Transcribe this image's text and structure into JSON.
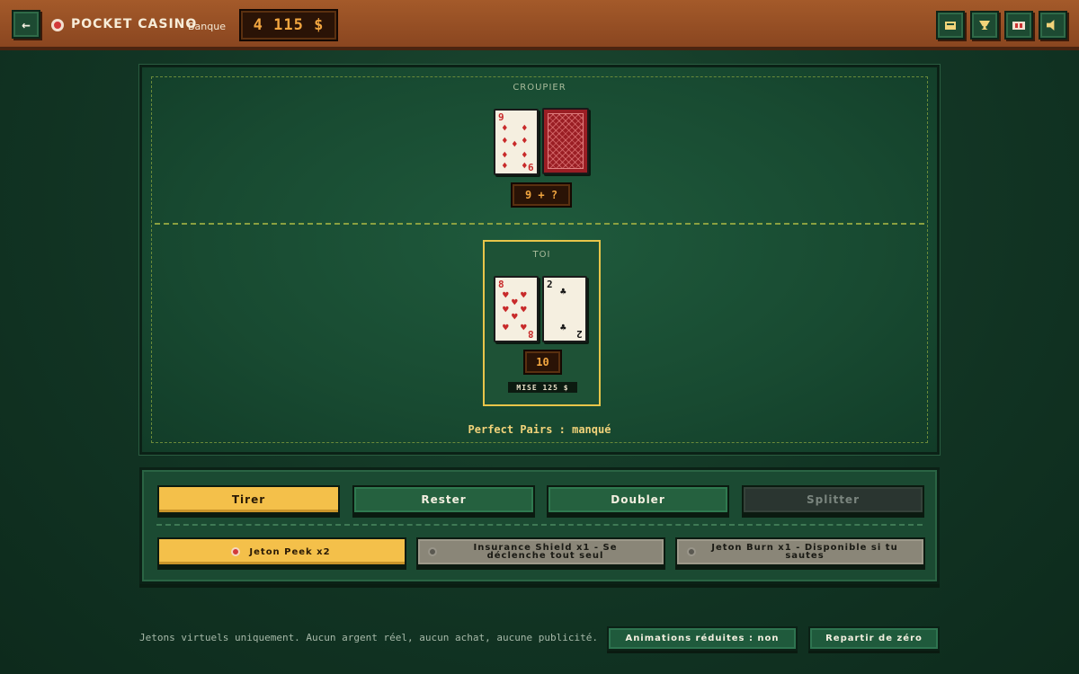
{
  "header": {
    "back_icon": "arrow-left-icon",
    "brand": "POCKET CASINO",
    "bank_label": "Banque",
    "bank_value": "4 115 $",
    "icons": [
      "mail-icon",
      "trophy-icon",
      "cards-icon",
      "speaker-icon"
    ]
  },
  "table": {
    "dealer_label": "CROUPIER",
    "dealer_cards": [
      {
        "rank": "9",
        "suit": "♦",
        "color": "#c82a2a"
      },
      {
        "face_down": true
      }
    ],
    "dealer_score": "9 + ?",
    "player_label": "TOI",
    "player_cards": [
      {
        "rank": "8",
        "suit": "♥",
        "color": "#c82a2a"
      },
      {
        "rank": "2",
        "suit": "♣",
        "color": "#141414"
      }
    ],
    "player_score": "10",
    "bet_label": "MISE 125 $",
    "side_bet_result": "Perfect Pairs : manqué"
  },
  "actions": {
    "hit": "Tirer",
    "stand": "Rester",
    "double": "Doubler",
    "split": "Splitter"
  },
  "chips": [
    {
      "label": "Jeton Peek x2",
      "state": "active"
    },
    {
      "label": "Insurance Shield x1 - Se déclenche tout seul",
      "state": "inactive"
    },
    {
      "label": "Jeton Burn x1 - Disponible si tu sautes",
      "state": "inactive"
    }
  ],
  "footer": {
    "note": "Jetons virtuels uniquement. Aucun argent réel, aucun achat, aucune publicité.",
    "reduced_animations": "Animations réduites : non",
    "reset": "Repartir de zéro"
  },
  "colors": {
    "felt": "#184a31",
    "wood": "#9a5226",
    "gold": "#f4c04a",
    "amber_text": "#f2a640"
  }
}
